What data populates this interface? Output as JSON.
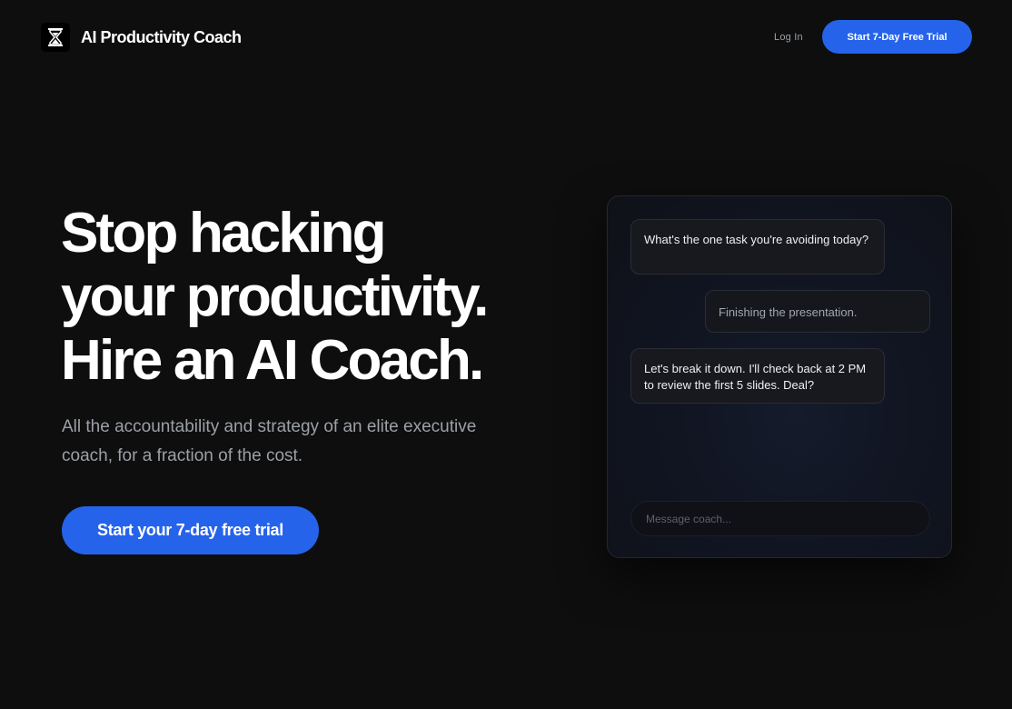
{
  "header": {
    "brand_icon": "hourglass-icon",
    "brand_name": "AI Productivity Coach",
    "login_label": "Log In",
    "cta_label": "Start 7-Day Free Trial"
  },
  "hero": {
    "title_lines": [
      "Stop hacking",
      "your productivity.",
      "Hire an AI Coach."
    ],
    "subtitle": "All the accountability and strategy of an elite executive coach, for a fraction of the cost.",
    "cta_label": "Start your 7-day free trial"
  },
  "chat": {
    "messages": [
      {
        "role": "coach",
        "text": "What's the one task you're avoiding today?"
      },
      {
        "role": "user",
        "text": "Finishing the presentation."
      },
      {
        "role": "coach",
        "text": "Let's break it down. I'll check back at 2 PM to review the first 5 slides. Deal?"
      }
    ],
    "input_placeholder": "Message coach...",
    "input_value": ""
  },
  "colors": {
    "background": "#0e0e0f",
    "accent": "#2563eb",
    "muted_text": "#9ca0a6"
  }
}
